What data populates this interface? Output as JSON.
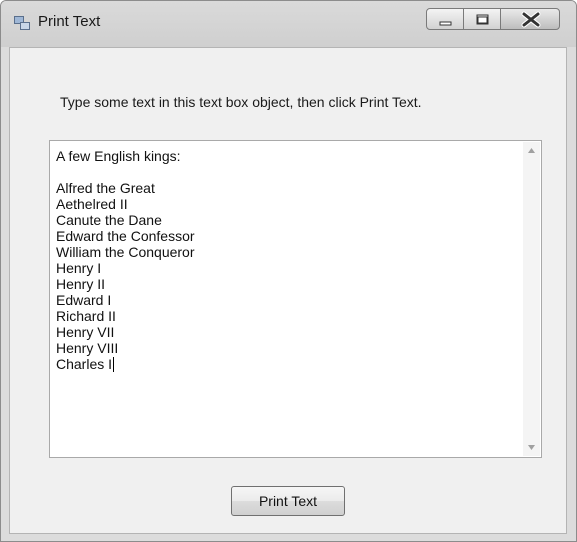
{
  "window": {
    "title": "Print Text",
    "icon": "form-window-icon"
  },
  "caption_buttons": {
    "minimize": "minimize-icon",
    "maximize": "maximize-icon",
    "close": "close-icon"
  },
  "form": {
    "instruction": "Type some text in this text box object, then click Print Text.",
    "textbox": {
      "lines": [
        "A few English kings:",
        "",
        "Alfred the Great",
        "Aethelred II",
        "Canute the Dane",
        "Edward the Confessor",
        "William the Conqueror",
        "Henry I",
        "Henry II",
        "Edward I",
        "Richard II",
        "Henry VII",
        "Henry VIII",
        "Charles I"
      ]
    },
    "print_button_label": "Print Text"
  }
}
